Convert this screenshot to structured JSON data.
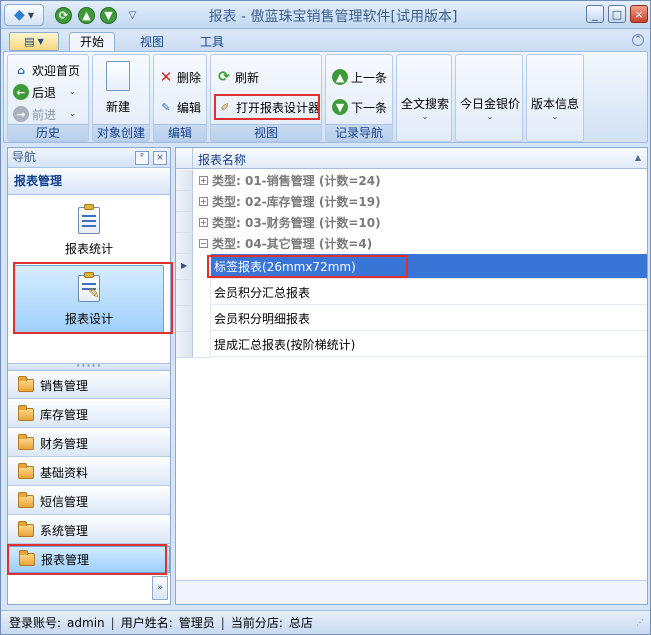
{
  "window": {
    "title": "报表 - 傲蓝珠宝销售管理软件[试用版本]",
    "minimize": "_",
    "maximize": "□",
    "close": "×"
  },
  "quick_access": {
    "orb_icon": "gem-icon",
    "dropdown": "▽"
  },
  "tabs": [
    {
      "label": "开始",
      "active": true
    },
    {
      "label": "视图",
      "active": false
    },
    {
      "label": "工具",
      "active": false
    }
  ],
  "ribbon": {
    "groups": {
      "history": "历史",
      "object_create": "对象创建",
      "edit": "编辑",
      "view": "视图",
      "record_nav": "记录导航"
    },
    "welcome": "欢迎首页",
    "back": "后退",
    "forward": "前进",
    "new": "新建",
    "delete": "删除",
    "edit": "编辑",
    "refresh": "刷新",
    "open_designer": "打开报表设计器",
    "prev": "上一条",
    "next": "下一条",
    "fulltext_search": "全文搜索",
    "gold_price": "今日金银价",
    "version_info": "版本信息"
  },
  "nav": {
    "header": "导航",
    "pin": "ᴾ",
    "close": "×",
    "section": "报表管理",
    "big_items": [
      {
        "label": "报表统计",
        "selected": false
      },
      {
        "label": "报表设计",
        "selected": true
      }
    ],
    "grip": "•••••",
    "items": [
      {
        "label": "销售管理",
        "selected": false
      },
      {
        "label": "库存管理",
        "selected": false
      },
      {
        "label": "财务管理",
        "selected": false
      },
      {
        "label": "基础资料",
        "selected": false
      },
      {
        "label": "短信管理",
        "selected": false
      },
      {
        "label": "系统管理",
        "selected": false
      },
      {
        "label": "报表管理",
        "selected": true
      }
    ],
    "more": "»"
  },
  "grid": {
    "column": "报表名称",
    "groups": [
      {
        "label": "类型: 01-销售管理 (计数=24)",
        "expanded": false
      },
      {
        "label": "类型: 02-库存管理 (计数=19)",
        "expanded": false
      },
      {
        "label": "类型: 03-财务管理 (计数=10)",
        "expanded": false
      },
      {
        "label": "类型: 04-其它管理 (计数=4)",
        "expanded": true
      }
    ],
    "rows": [
      {
        "label": "标签报表(26mmx72mm)",
        "selected": true
      },
      {
        "label": "会员积分汇总报表",
        "selected": false
      },
      {
        "label": "会员积分明细报表",
        "selected": false
      },
      {
        "label": "提成汇总报表(按阶梯统计)",
        "selected": false
      }
    ]
  },
  "status": {
    "account_label": "登录账号:",
    "account": "admin",
    "sep": "|",
    "user_label": "用户姓名:",
    "user": "管理员",
    "branch_label": "当前分店:",
    "branch": "总店"
  }
}
